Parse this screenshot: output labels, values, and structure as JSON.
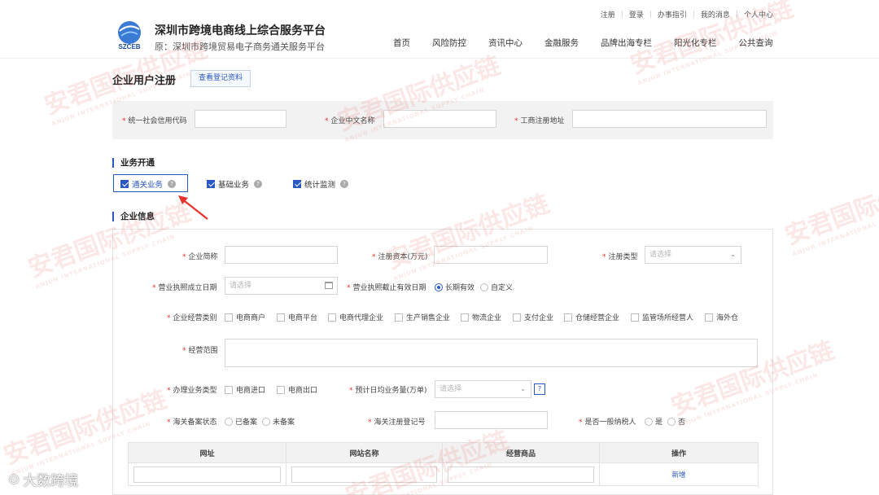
{
  "header": {
    "logo_text": "SZCEB",
    "title": "深圳市跨境电商线上综合服务平台",
    "subtitle": "原：深圳市跨境贸易电子商务通关服务平台",
    "util_links": [
      "注册",
      "登录",
      "办事指引",
      "我的消息",
      "个人中心"
    ],
    "nav": [
      "首页",
      "风险防控",
      "资讯中心",
      "金融服务",
      "品牌出海专栏",
      "阳光化专栏",
      "公共查询"
    ]
  },
  "page": {
    "title": "企业用户注册",
    "view_button": "查看登记资料"
  },
  "search": {
    "credit_code": "统一社会信用代码",
    "cn_name": "企业中文名称",
    "reg_address": "工商注册地址"
  },
  "business": {
    "heading": "业务开通",
    "items": [
      "通关业务",
      "基础业务",
      "统计监测"
    ],
    "help": "?"
  },
  "info": {
    "heading": "企业信息",
    "short_name": "企业简称",
    "reg_capital": "注册资本(万元)",
    "reg_type": "注册类型",
    "select_placeholder": "请选择",
    "license_date": "营业执照成立日期",
    "license_expiry": "营业执照截止有效日期",
    "expiry_options": [
      "长期有效",
      "自定义"
    ],
    "biz_category": "企业经营类别",
    "categories": [
      "电商商户",
      "电商平台",
      "电商代理企业",
      "生产销售企业",
      "物流企业",
      "支付企业",
      "仓储经营企业",
      "监管场所经营人",
      "海外仓"
    ],
    "scope": "经营范围",
    "biz_type": "办理业务类型",
    "biz_type_options": [
      "电商进口",
      "电商出口"
    ],
    "daily_volume": "预计日均业务量(万单)",
    "customs_status": "海关备案状态",
    "customs_options": [
      "已备案",
      "未备案"
    ],
    "customs_reg_no": "海关注册登记号",
    "general_taxpayer": "是否一般纳税人",
    "taxpayer_options": [
      "是",
      "否"
    ]
  },
  "table": {
    "headers": [
      "网址",
      "网站名称",
      "经营商品",
      "操作"
    ],
    "add_link": "新增"
  },
  "watermark": {
    "text": "安君国际供应链",
    "sub": "ANJUN INTERNATIONAL SUPPLY CHAIN"
  },
  "footer_logo": "大数跨境"
}
